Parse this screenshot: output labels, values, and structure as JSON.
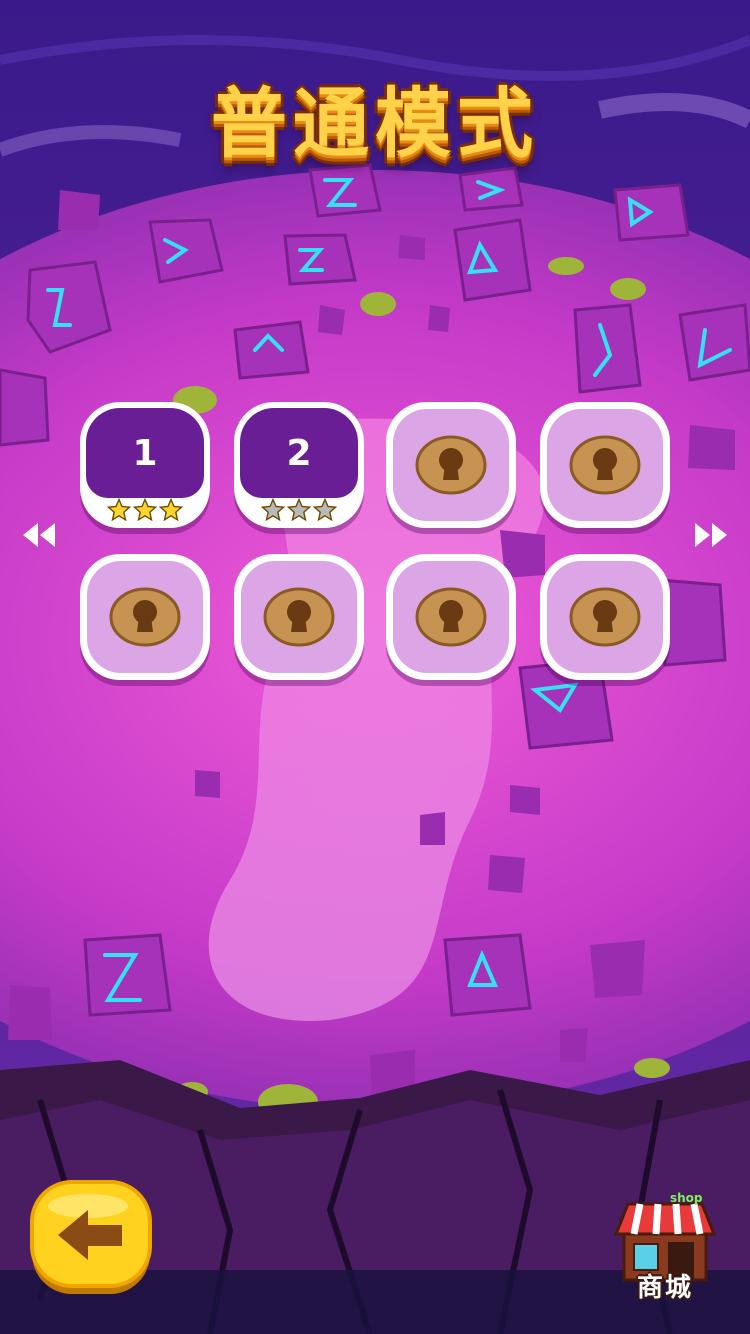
{
  "header": {
    "title": "普通模式"
  },
  "levels": [
    {
      "label": "1",
      "state": "unlocked",
      "stars": 3
    },
    {
      "label": "2",
      "state": "unlocked",
      "stars": 0
    },
    {
      "label": "",
      "state": "locked",
      "stars": 0
    },
    {
      "label": "",
      "state": "locked",
      "stars": 0
    },
    {
      "label": "",
      "state": "locked",
      "stars": 0
    },
    {
      "label": "",
      "state": "locked",
      "stars": 0
    },
    {
      "label": "",
      "state": "locked",
      "stars": 0
    },
    {
      "label": "",
      "state": "locked",
      "stars": 0
    }
  ],
  "max_stars": 3,
  "shop": {
    "label": "商城",
    "sign": "shop"
  },
  "icons": {
    "prev": "double-chevron-left-icon",
    "next": "double-chevron-right-icon",
    "back": "arrow-left-icon",
    "shop": "shop-icon",
    "lock": "lock-icon"
  },
  "colors": {
    "sky": "#3a1a8a",
    "ground": "#c43ac8",
    "path": "#e98be6",
    "level_unlocked": "#6a1e96",
    "level_locked": "#dca6e6",
    "star_earned": "#ffd52e",
    "star_empty": "#b9b9b9",
    "back_button": "#ffd21f"
  }
}
